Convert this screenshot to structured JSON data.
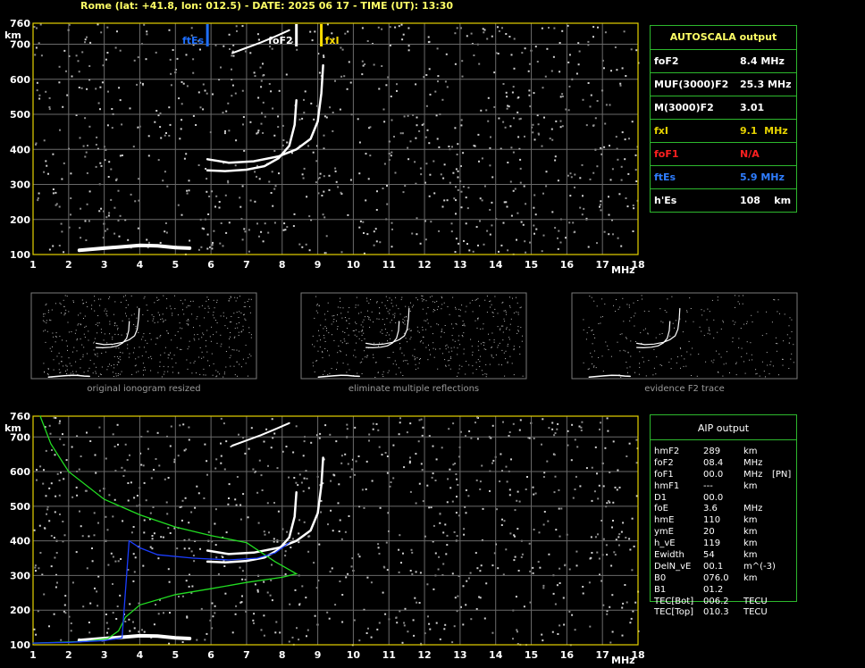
{
  "header": {
    "title": "Rome (lat: +41.8, lon: 012.5) - DATE: 2025 06 17 - TIME (UT): 13:30"
  },
  "chart_data": [
    {
      "type": "scatter",
      "name": "main-ionogram",
      "xlabel": "MHz",
      "ylabel": "km",
      "xlim": [
        1,
        18
      ],
      "ylim": [
        100,
        760
      ],
      "x_ticks": [
        "1",
        "2",
        "3",
        "4",
        "5",
        "6",
        "7",
        "8",
        "9",
        "10",
        "11",
        "12",
        "13",
        "14",
        "15",
        "16",
        "17",
        "18"
      ],
      "y_ticks": [
        "100",
        "200",
        "300",
        "400",
        "500",
        "600",
        "700",
        "760"
      ],
      "grid": true,
      "markers": [
        {
          "label": "ftEs",
          "freq": 5.9,
          "color": "#1e6fff"
        },
        {
          "label": "foF2",
          "freq": 8.4,
          "color": "#ffffff"
        },
        {
          "label": "fxI",
          "freq": 9.1,
          "color": "#ffdd00"
        }
      ],
      "traces": {
        "es_layer": [
          [
            2.3,
            112
          ],
          [
            3,
            118
          ],
          [
            3.5,
            122
          ],
          [
            4,
            126
          ],
          [
            4.5,
            125
          ],
          [
            5,
            120
          ],
          [
            5.4,
            118
          ]
        ],
        "o_trace": [
          [
            5.9,
            340
          ],
          [
            6.4,
            338
          ],
          [
            7,
            342
          ],
          [
            7.5,
            352
          ],
          [
            7.9,
            375
          ],
          [
            8.2,
            410
          ],
          [
            8.35,
            470
          ],
          [
            8.4,
            540
          ]
        ],
        "x_trace": [
          [
            5.9,
            372
          ],
          [
            6.5,
            362
          ],
          [
            7.2,
            366
          ],
          [
            7.9,
            380
          ],
          [
            8.4,
            400
          ],
          [
            8.8,
            430
          ],
          [
            9.0,
            480
          ],
          [
            9.1,
            560
          ],
          [
            9.15,
            640
          ]
        ],
        "multiple_reflection": [
          [
            6.6,
            675
          ],
          [
            7.0,
            690
          ],
          [
            7.4,
            705
          ],
          [
            7.8,
            722
          ],
          [
            8.2,
            740
          ]
        ]
      }
    },
    {
      "type": "scatter",
      "name": "aip-ionogram",
      "xlabel": "MHz",
      "ylabel": "km",
      "xlim": [
        1,
        18
      ],
      "ylim": [
        100,
        760
      ],
      "x_ticks": [
        "1",
        "2",
        "3",
        "4",
        "5",
        "6",
        "7",
        "8",
        "9",
        "10",
        "11",
        "12",
        "13",
        "14",
        "15",
        "16",
        "17",
        "18"
      ],
      "y_ticks": [
        "100",
        "200",
        "300",
        "400",
        "500",
        "600",
        "700",
        "760"
      ],
      "grid": true,
      "series": [
        {
          "color": "#22dd22",
          "points": [
            [
              1.2,
              760
            ],
            [
              1.5,
              680
            ],
            [
              2,
              600
            ],
            [
              3,
              520
            ],
            [
              4,
              475
            ],
            [
              5,
              440
            ],
            [
              6,
              415
            ],
            [
              7,
              395
            ],
            [
              7.8,
              340
            ],
            [
              8.4,
              305
            ],
            [
              8,
              295
            ],
            [
              7,
              280
            ],
            [
              6,
              262
            ],
            [
              5,
              245
            ],
            [
              4,
              215
            ],
            [
              3.6,
              180
            ],
            [
              3.4,
              140
            ],
            [
              3.1,
              118
            ],
            [
              2.5,
              110
            ],
            [
              2,
              108
            ],
            [
              1,
              105
            ]
          ]
        },
        {
          "color": "#1a3dff",
          "points": [
            [
              1,
              105
            ],
            [
              2,
              107
            ],
            [
              3,
              112
            ],
            [
              3.5,
              120
            ],
            [
              3.7,
              400
            ],
            [
              4,
              380
            ],
            [
              4.5,
              360
            ],
            [
              5.5,
              350
            ],
            [
              6.5,
              345
            ],
            [
              7.3,
              350
            ],
            [
              7.8,
              365
            ],
            [
              8.2,
              395
            ]
          ]
        }
      ]
    }
  ],
  "autoscala": {
    "title": "AUTOSCALA output",
    "rows": [
      {
        "label": "foF2",
        "value": "8.4 MHz",
        "color": "#ffffff"
      },
      {
        "label": "MUF(3000)F2",
        "value": "25.3 MHz",
        "color": "#ffffff"
      },
      {
        "label": "M(3000)F2",
        "value": "3.01",
        "color": "#ffffff"
      },
      {
        "label": "fxI",
        "value": "9.1  MHz",
        "color": "#e6d200"
      },
      {
        "label": "foF1",
        "value": "N/A",
        "color": "#ff2020"
      },
      {
        "label": "ftEs",
        "value": "5.9 MHz",
        "color": "#2f7dff"
      },
      {
        "label": "h'Es",
        "value": "108    km",
        "color": "#ffffff"
      }
    ]
  },
  "thumbnails": [
    {
      "caption": "original ionogram resized"
    },
    {
      "caption": "eliminate multiple reflections"
    },
    {
      "caption": "evidence F2 trace"
    }
  ],
  "aip": {
    "title": "AIP output",
    "rows": [
      {
        "name": "hmF2",
        "value": "289",
        "unit": "km",
        "note": ""
      },
      {
        "name": "foF2",
        "value": "08.4",
        "unit": "MHz",
        "note": ""
      },
      {
        "name": "foF1",
        "value": "00.0",
        "unit": "MHz",
        "note": "[PN]"
      },
      {
        "name": "hmF1",
        "value": "---",
        "unit": "km",
        "note": ""
      },
      {
        "name": "D1",
        "value": "00.0",
        "unit": "",
        "note": ""
      },
      {
        "name": "foE",
        "value": "3.6",
        "unit": "MHz",
        "note": ""
      },
      {
        "name": "hmE",
        "value": "110",
        "unit": "km",
        "note": ""
      },
      {
        "name": "ymE",
        "value": "20",
        "unit": "km",
        "note": ""
      },
      {
        "name": "h_vE",
        "value": "119",
        "unit": "km",
        "note": ""
      },
      {
        "name": "Ewidth",
        "value": "54",
        "unit": "km",
        "note": ""
      },
      {
        "name": "DelN_vE",
        "value": "00.1",
        "unit": "m^(-3)",
        "note": ""
      },
      {
        "name": "B0",
        "value": "076.0",
        "unit": "km",
        "note": ""
      },
      {
        "name": "B1",
        "value": "01.2",
        "unit": "",
        "note": ""
      },
      {
        "name": "TEC[Bot]",
        "value": "006.2",
        "unit": "TECU",
        "note": ""
      },
      {
        "name": "TEC[Top]",
        "value": "010.3",
        "unit": "TECU",
        "note": ""
      }
    ]
  }
}
